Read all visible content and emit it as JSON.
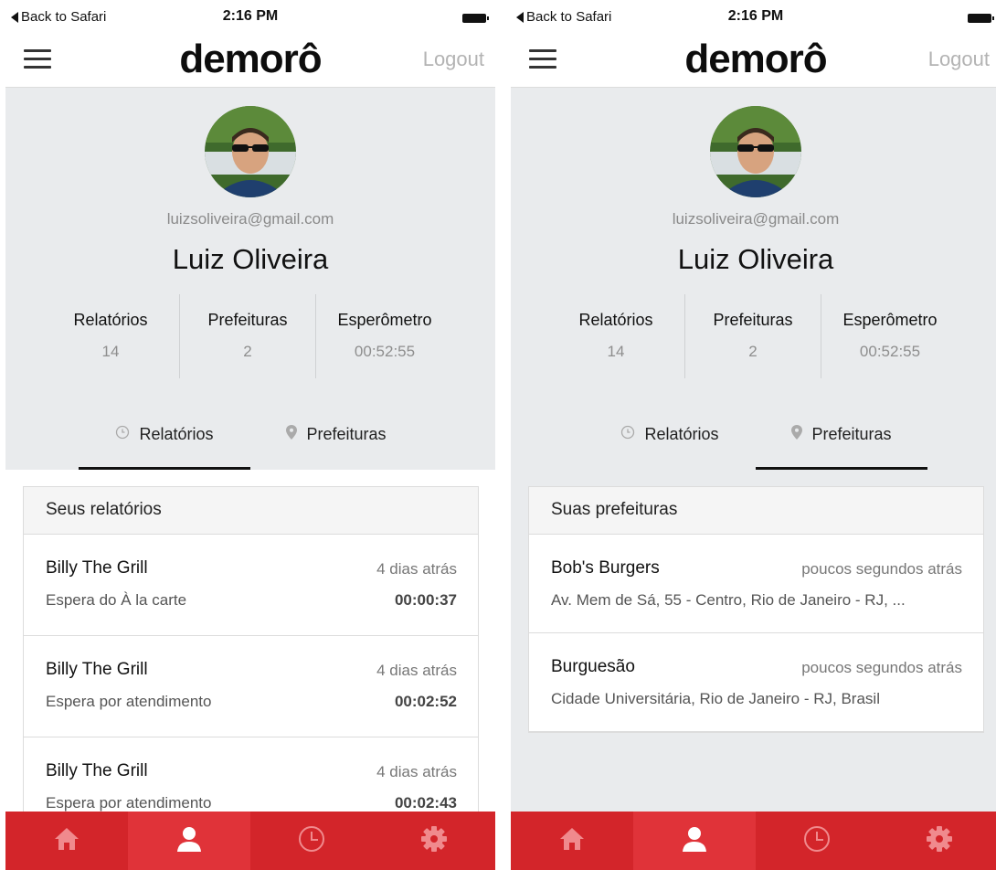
{
  "screens": [
    {
      "status": {
        "back": "Back to Safari",
        "time": "2:16 PM"
      },
      "header": {
        "brand": "demorô",
        "logout": "Logout"
      },
      "profile": {
        "email": "luizsoliveira@gmail.com",
        "name": "Luiz Oliveira",
        "stats": [
          {
            "label": "Relatórios",
            "value": "14"
          },
          {
            "label": "Prefeituras",
            "value": "2"
          },
          {
            "label": "Esperômetro",
            "value": "00:52:55"
          }
        ]
      },
      "tabs": [
        {
          "label": "Relatórios",
          "active": true
        },
        {
          "label": "Prefeituras",
          "active": false
        }
      ],
      "card": {
        "title": "Seus relatórios",
        "items": [
          {
            "name": "Billy The Grill",
            "when": "4 dias atrás",
            "sub": "Espera do À la carte",
            "duration": "00:00:37"
          },
          {
            "name": "Billy The Grill",
            "when": "4 dias atrás",
            "sub": "Espera por atendimento",
            "duration": "00:02:52"
          },
          {
            "name": "Billy The Grill",
            "when": "4 dias atrás",
            "sub": "Espera por atendimento",
            "duration": "00:02:43"
          }
        ]
      },
      "nav_active": "profile"
    },
    {
      "status": {
        "back": "Back to Safari",
        "time": "2:16 PM"
      },
      "header": {
        "brand": "demorô",
        "logout": "Logout"
      },
      "profile": {
        "email": "luizsoliveira@gmail.com",
        "name": "Luiz Oliveira",
        "stats": [
          {
            "label": "Relatórios",
            "value": "14"
          },
          {
            "label": "Prefeituras",
            "value": "2"
          },
          {
            "label": "Esperômetro",
            "value": "00:52:55"
          }
        ]
      },
      "tabs": [
        {
          "label": "Relatórios",
          "active": false
        },
        {
          "label": "Prefeituras",
          "active": true
        }
      ],
      "card": {
        "title": "Suas prefeituras",
        "items": [
          {
            "name": "Bob's Burgers",
            "when": "poucos segundos atrás",
            "sub": "Av. Mem de Sá, 55 - Centro, Rio de Janeiro - RJ, ..."
          },
          {
            "name": "Burguesão",
            "when": "poucos segundos atrás",
            "sub": "Cidade Universitária, Rio de Janeiro - RJ, Brasil"
          }
        ]
      },
      "nav_active": "profile"
    }
  ],
  "nav_icons": [
    "home-icon",
    "profile-icon",
    "clock-icon",
    "gear-icon"
  ],
  "colors": {
    "nav_bg": "#d3252a",
    "nav_active_bg": "#e03339",
    "profile_bg": "#e9ebed"
  }
}
